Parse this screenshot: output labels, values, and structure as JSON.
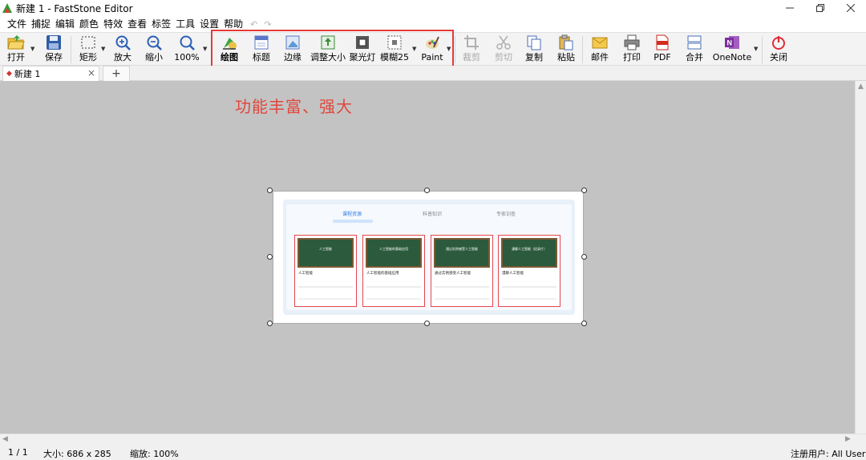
{
  "window": {
    "title": "新建 1 - FastStone Editor",
    "controls": [
      "minimize-icon",
      "restore-icon",
      "close-icon"
    ]
  },
  "menu": {
    "items": [
      "文件",
      "捕捉",
      "编辑",
      "颜色",
      "特效",
      "查看",
      "标签",
      "工具",
      "设置",
      "帮助"
    ]
  },
  "toolbar": {
    "open": "打开",
    "save": "保存",
    "rect": "矩形",
    "zoom_in": "放大",
    "zoom_out": "缩小",
    "zoom_level": "100%",
    "draw": "绘图",
    "caption": "标题",
    "edge": "边缘",
    "resize": "调整大小",
    "spotlight": "聚光灯",
    "blur": "模糊25",
    "paint": "Paint",
    "crop": "裁剪",
    "cut": "剪切",
    "copy": "复制",
    "paste": "粘贴",
    "mail": "邮件",
    "print": "打印",
    "pdf": "PDF",
    "merge": "合并",
    "onenote": "OneNote",
    "close": "关闭"
  },
  "tabs": {
    "active_label": "新建 1",
    "add_label": "+"
  },
  "annotation": {
    "text": "功能丰富、强大"
  },
  "canvas_image": {
    "tabs": [
      "课程资源",
      "科普知识",
      "专家训查"
    ],
    "cards": [
      {
        "board_title": "人工智能",
        "title": "人工智能"
      },
      {
        "board_title": "人工智能的基础应用",
        "title": "人工智能的基础应用"
      },
      {
        "board_title": "通过实例感受人工智能",
        "title": "通过实例感受人工智能"
      },
      {
        "board_title": "漫聊人工智能（纪录片）",
        "title": "漫聊人工智能"
      }
    ]
  },
  "statusbar": {
    "page": "1 / 1",
    "size": "大小:  686 x 285",
    "zoom": "缩放:  100%",
    "user": "注册用户:  All User"
  },
  "colors": {
    "highlight_border": "#e43a3a",
    "annotation_text": "#e0473d",
    "workspace_bg": "#c3c3c3"
  }
}
